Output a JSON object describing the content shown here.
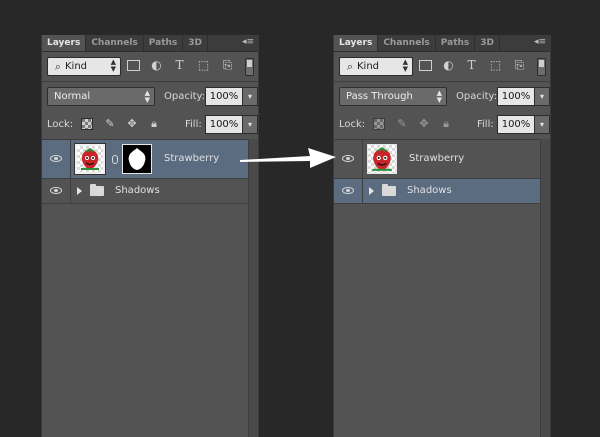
{
  "colors": {
    "background": "#282828",
    "panel": "#535353",
    "selected_row": "#5b6b80",
    "strawberry_red": "#c8242a",
    "leaf_green": "#2f8f3a"
  },
  "panels": [
    {
      "tabs": [
        "Layers",
        "Channels",
        "Paths",
        "3D"
      ],
      "menu_icon": "panel-menu-icon",
      "filter": {
        "kind_label": "Kind",
        "icons": [
          "image-filter-icon",
          "adjustment-filter-icon",
          "type-filter-icon",
          "shape-filter-icon",
          "smart-object-filter-icon"
        ]
      },
      "blend_mode": "Normal",
      "opacity_label": "Opacity:",
      "opacity": "100%",
      "lock_label": "Lock:",
      "lock_icons": [
        "lock-transparent-icon",
        "lock-image-icon",
        "lock-position-icon",
        "lock-all-icon"
      ],
      "fill_label": "Fill:",
      "fill": "100%",
      "layers": [
        {
          "name": "Strawberry",
          "selected": true,
          "has_mask": true
        },
        {
          "name": "Shadows",
          "type": "group",
          "selected": false
        }
      ]
    },
    {
      "tabs": [
        "Layers",
        "Channels",
        "Paths",
        "3D"
      ],
      "menu_icon": "panel-menu-icon",
      "filter": {
        "kind_label": "Kind",
        "icons": [
          "image-filter-icon",
          "adjustment-filter-icon",
          "type-filter-icon",
          "shape-filter-icon",
          "smart-object-filter-icon"
        ]
      },
      "blend_mode": "Pass Through",
      "opacity_label": "Opacity:",
      "opacity": "100%",
      "lock_label": "Lock:",
      "lock_icons": [
        "lock-transparent-icon",
        "lock-image-icon",
        "lock-position-icon",
        "lock-all-icon"
      ],
      "fill_label": "Fill:",
      "fill": "100%",
      "layers": [
        {
          "name": "Strawberry",
          "selected": false,
          "has_mask": false
        },
        {
          "name": "Shadows",
          "type": "group",
          "selected": true
        }
      ]
    }
  ],
  "annotation": {
    "icon": "right-arrow-icon"
  }
}
